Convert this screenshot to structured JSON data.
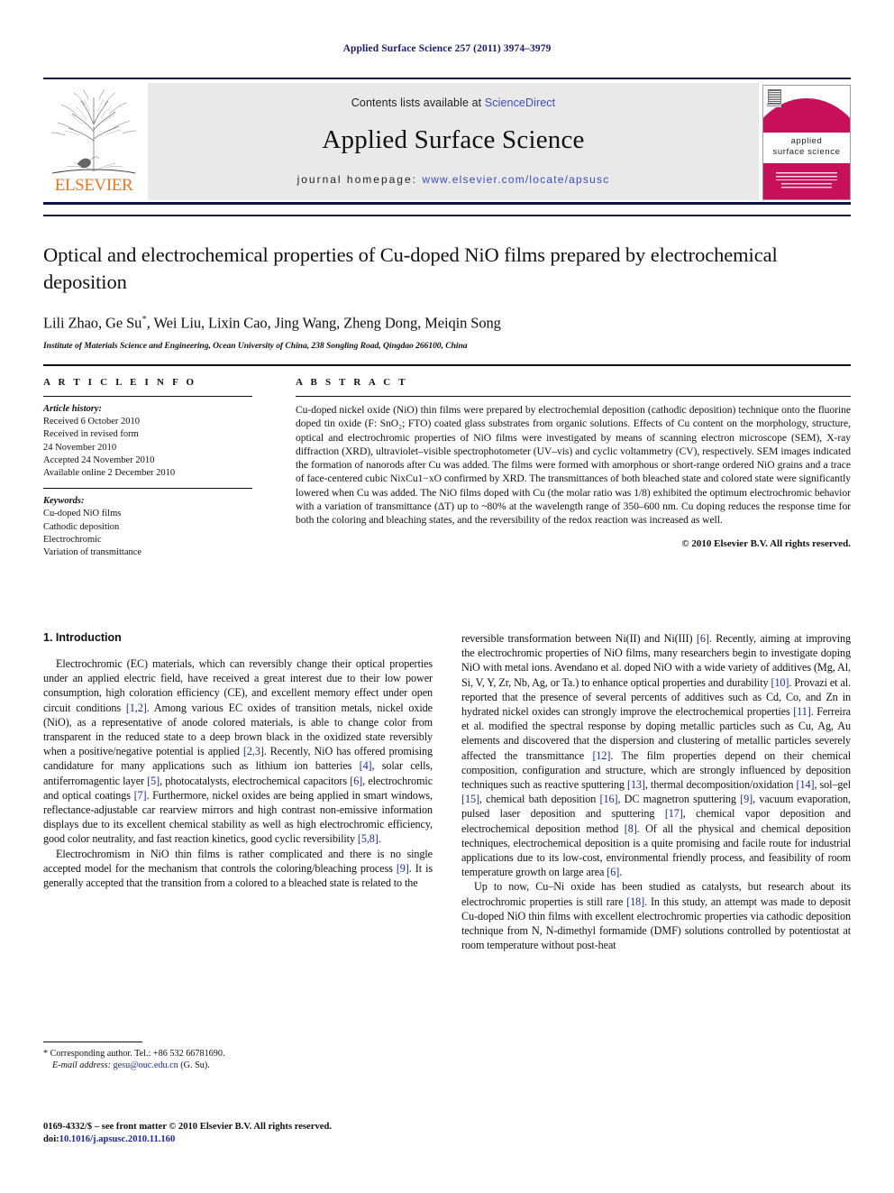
{
  "running_head": "Applied Surface Science 257 (2011) 3974–3979",
  "masthead": {
    "publisher": "ELSEVIER",
    "contents_prefix": "Contents lists available at ",
    "contents_link": "ScienceDirect",
    "journal_name": "Applied Surface Science",
    "homepage_prefix": "journal homepage:",
    "homepage_url": "www.elsevier.com/locate/apsusc",
    "cover_title_line1": "applied",
    "cover_title_line2": "surface science",
    "cover_color": "#c8105a",
    "link_color": "#3b4cc0"
  },
  "article": {
    "title": "Optical and electrochemical properties of Cu-doped NiO films prepared by electrochemical deposition",
    "authors": "Lili Zhao, Ge Su*, Wei Liu, Lixin Cao, Jing Wang, Zheng Dong, Meiqin Song",
    "affiliation": "Institute of Materials Science and Engineering, Ocean University of China, 238 Songling Road, Qingdao 266100, China"
  },
  "article_info": {
    "heading": "A R T I C L E    I N F O",
    "history_label": "Article history:",
    "history": [
      "Received 6 October 2010",
      "Received in revised form",
      "24 November 2010",
      "Accepted 24 November 2010",
      "Available online 2 December 2010"
    ],
    "keywords_label": "Keywords:",
    "keywords": [
      "Cu-doped NiO films",
      "Cathodic deposition",
      "Electrochromic",
      "Variation of transmittance"
    ]
  },
  "abstract": {
    "heading": "A B S T R A C T",
    "text": "Cu-doped nickel oxide (NiO) thin films were prepared by electrochemial deposition (cathodic deposition) technique onto the fluorine doped tin oxide (F: SnO₂; FTO) coated glass substrates from organic solutions. Effects of Cu content on the morphology, structure, optical and electrochromic properties of NiO films were investigated by means of scanning electron microscope (SEM), X-ray diffraction (XRD), ultraviolet–visible spectrophotometer (UV–vis) and cyclic voltammetry (CV), respectively. SEM images indicated the formation of nanorods after Cu was added. The films were formed with amorphous or short-range ordered NiO grains and a trace of face-centered cubic NixCu1−xO confirmed by XRD. The transmittances of both bleached state and colored state were significantly lowered when Cu was added. The NiO films doped with Cu (the molar ratio was 1/8) exhibited the optimum electrochromic behavior with a variation of transmittance (ΔT) up to ~80% at the wavelength range of 350–600 nm. Cu doping reduces the response time for both the coloring and bleaching states, and the reversibility of the redox reaction was increased as well.",
    "copyright": "© 2010 Elsevier B.V. All rights reserved."
  },
  "body": {
    "section_heading": "1.  Introduction",
    "left_paragraphs": [
      "Electrochromic (EC) materials, which can reversibly change their optical properties under an applied electric field, have received a great interest due to their low power consumption, high coloration efficiency (CE), and excellent memory effect under open circuit conditions [1,2]. Among various EC oxides of transition metals, nickel oxide (NiO), as a representative of anode colored materials, is able to change color from transparent in the reduced state to a deep brown black in the oxidized state reversibly when a positive/negative potential is applied [2,3]. Recently, NiO has offered promising candidature for many applications such as lithium ion batteries [4], solar cells, antiferromagentic layer [5], photocatalysts, electrochemical capacitors [6], electrochromic and optical coatings [7]. Furthermore, nickel oxides are being applied in smart windows, reflectance-adjustable car rearview mirrors and high contrast non-emissive information displays due to its excellent chemical stability as well as high electrochromic efficiency, good color neutrality, and fast reaction kinetics, good cyclic reversibility [5,8].",
      "Electrochromism in NiO thin films is rather complicated and there is no single accepted model for the mechanism that controls the coloring/bleaching process [9]. It is generally accepted that the transition from a colored to a bleached state is related to the"
    ],
    "right_paragraphs": [
      "reversible transformation between Ni(II) and Ni(III) [6]. Recently, aiming at improving the electrochromic properties of NiO films, many researchers begin to investigate doping NiO with metal ions. Avendano et al. doped NiO with a wide variety of additives (Mg, Al, Si, V, Y, Zr, Nb, Ag, or Ta.) to enhance optical properties and durability [10]. Provazi et al. reported that the presence of several percents of additives such as Cd, Co, and Zn in hydrated nickel oxides can strongly improve the electrochemical properties [11]. Ferreira et al. modified the spectral response by doping metallic particles such as Cu, Ag, Au elements and discovered that the dispersion and clustering of metallic particles severely affected the transmittance [12]. The film properties depend on their chemical composition, configuration and structure, which are strongly influenced by deposition techniques such as reactive sputtering [13], thermal decomposition/oxidation [14], sol–gel [15], chemical bath deposition [16], DC magnetron sputtering [9], vacuum evaporation, pulsed laser deposition and sputtering [17], chemical vapor deposition and electrochemical deposition method [8]. Of all the physical and chemical deposition techniques, electrochemical deposition is a quite promising and facile route for industrial applications due to its low-cost, environmental friendly process, and feasibility of room temperature growth on large area [6].",
      "Up to now, Cu–Ni oxide has been studied as catalysts, but research about its electrochromic properties is still rare [18]. In this study, an attempt was made to deposit Cu-doped NiO thin films with excellent electrochromic properties via cathodic deposition technique from N, N-dimethyl formamide (DMF) solutions controlled by potentiostat at room temperature without post-heat"
    ]
  },
  "footnotes": {
    "corresponding": "* Corresponding author. Tel.: +86 532 66781690.",
    "email_label": "E-mail address:",
    "email": "gesu@ouc.edu.cn",
    "email_suffix": "(G. Su).",
    "imprint": "0169-4332/$ – see front matter © 2010 Elsevier B.V. All rights reserved.",
    "doi_label": "doi:",
    "doi": "10.1016/j.apsusc.2010.11.160"
  }
}
